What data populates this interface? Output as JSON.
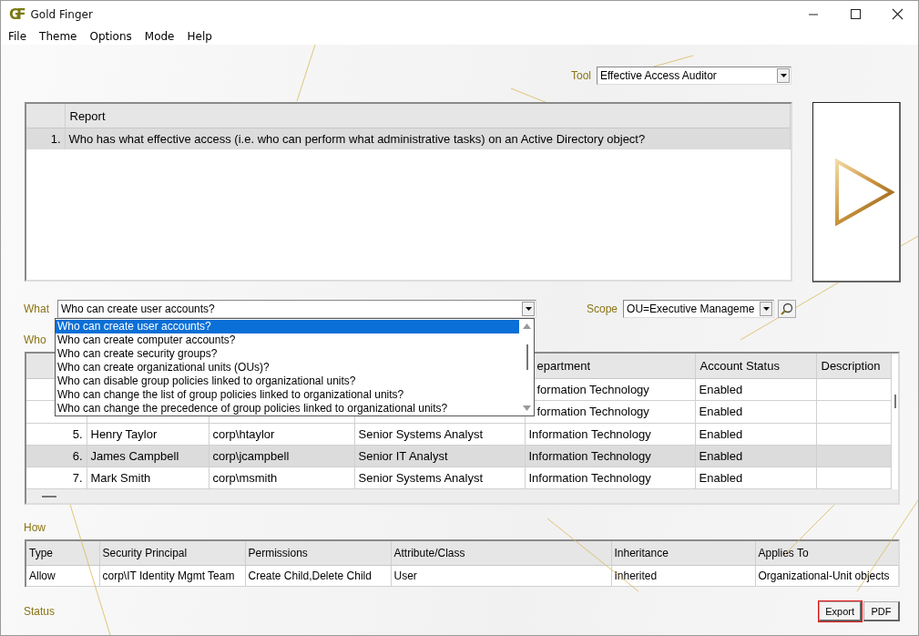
{
  "window": {
    "logo": "GF",
    "title": "Gold Finger"
  },
  "menu": [
    "File",
    "Theme",
    "Options",
    "Mode",
    "Help"
  ],
  "tool": {
    "label": "Tool",
    "value": "Effective Access Auditor"
  },
  "reports": {
    "columns": [
      "Report"
    ],
    "rows": [
      {
        "number": "1.",
        "report": "Who has what effective access (i.e. who can perform what administrative tasks) on an Active Directory object?",
        "selected": true
      }
    ]
  },
  "what": {
    "label": "What",
    "value": "Who can create user accounts?",
    "options": [
      {
        "label": "Who can create user accounts?",
        "selected": true
      },
      {
        "label": "Who can create computer accounts?",
        "selected": false
      },
      {
        "label": "Who can create security groups?",
        "selected": false
      },
      {
        "label": "Who can create organizational units (OUs)?",
        "selected": false
      },
      {
        "label": "Who can disable group policies linked to organizational units?",
        "selected": false
      },
      {
        "label": "Who can change the list of group policies linked to organizational units?",
        "selected": false
      },
      {
        "label": "Who can change the precedence of group policies linked to organizational units?",
        "selected": false
      }
    ]
  },
  "scope": {
    "label": "Scope",
    "value": "OU=Executive Manageme"
  },
  "who": {
    "label": "Who",
    "columns": {
      "department": "epartment",
      "account_status": "Account Status",
      "description": "Description"
    },
    "rows": [
      {
        "department": "formation Technology",
        "account_status": "Enabled",
        "selected": false
      },
      {
        "department": "formation Technology",
        "account_status": "Enabled",
        "selected": false
      },
      {
        "column_1": "5.",
        "column_2": "Henry Taylor",
        "column_3": "corp\\htaylor",
        "column_4": "Senior Systems Analyst",
        "department": "Information Technology",
        "account_status": "Enabled",
        "selected": false
      },
      {
        "column_1": "6.",
        "column_2": "James Campbell",
        "column_3": "corp\\jcampbell",
        "column_4": "Senior IT Analyst",
        "department": "Information Technology",
        "account_status": "Enabled",
        "selected": true
      },
      {
        "column_1": "7.",
        "column_2": "Mark Smith",
        "column_3": "corp\\msmith",
        "column_4": "Senior Systems Analyst",
        "department": "Information Technology",
        "account_status": "Enabled",
        "selected": false
      }
    ]
  },
  "how": {
    "label": "How",
    "columns": [
      "Type",
      "Security Principal",
      "Permissions",
      "Attribute/Class",
      "Inheritance",
      "Applies To"
    ],
    "rows": [
      {
        "cells": [
          "Allow",
          "corp\\IT Identity Mgmt Team",
          "Create Child,Delete Child",
          "User",
          "Inherited",
          "Organizational-Unit objects"
        ]
      }
    ]
  },
  "status": {
    "label": "Status"
  },
  "buttons": [
    {
      "label": "Export",
      "focused": true
    },
    {
      "label": "PDF",
      "focused": false
    }
  ]
}
